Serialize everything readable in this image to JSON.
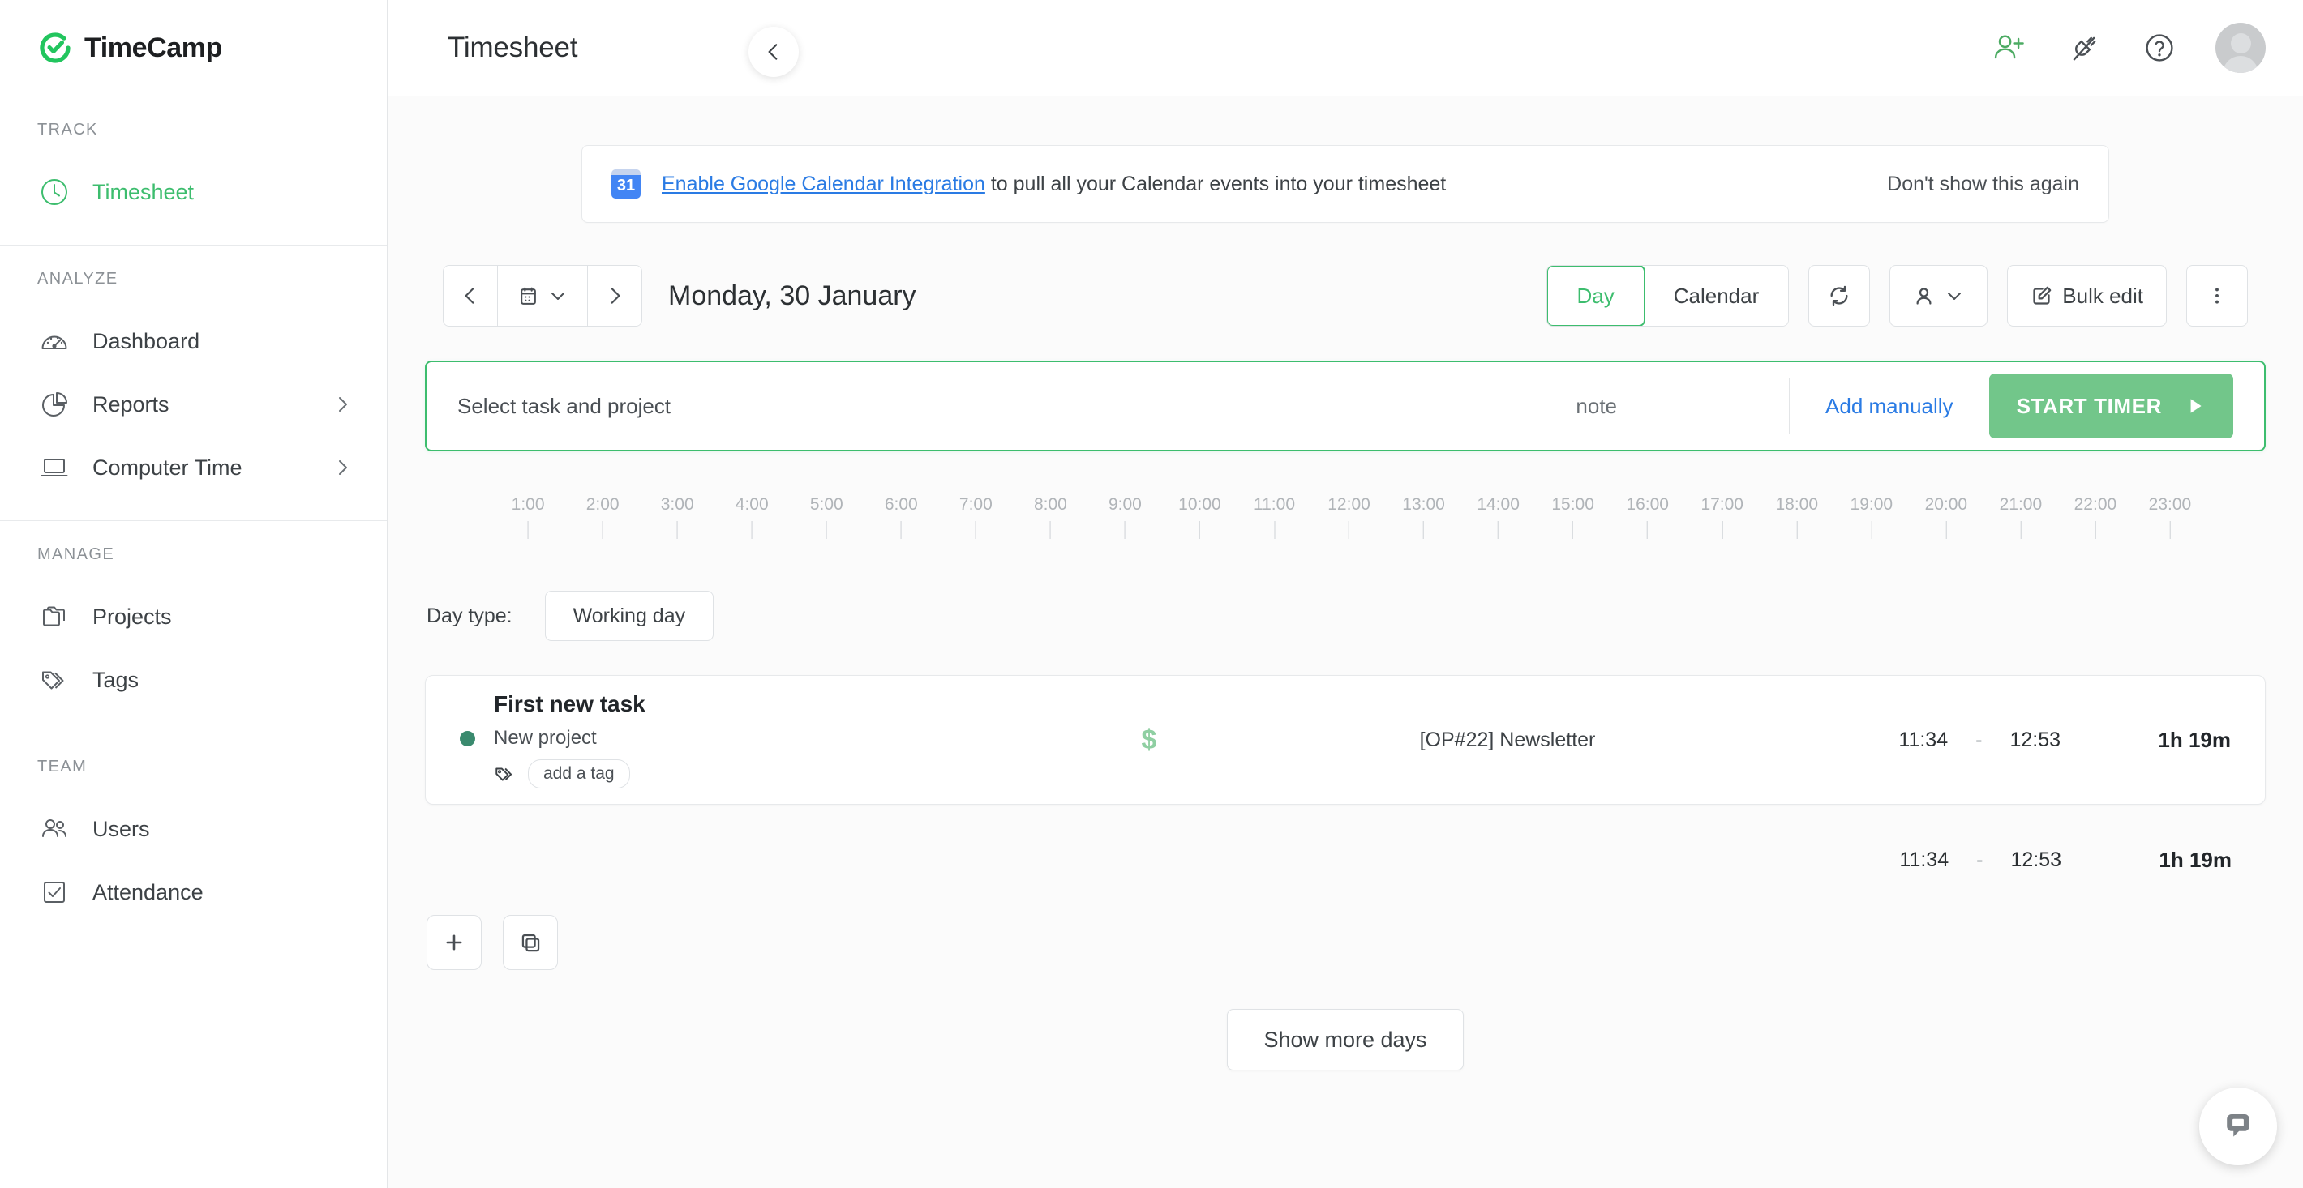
{
  "brand": {
    "name": "TimeCamp",
    "accent": "#3dbd6e"
  },
  "sidebar": {
    "sections": [
      {
        "label": "TRACK",
        "items": [
          {
            "label": "Timesheet",
            "icon": "clock-icon",
            "active": true,
            "chevron": false
          }
        ]
      },
      {
        "label": "ANALYZE",
        "items": [
          {
            "label": "Dashboard",
            "icon": "gauge-icon",
            "active": false,
            "chevron": false
          },
          {
            "label": "Reports",
            "icon": "pie-chart-icon",
            "active": false,
            "chevron": true
          },
          {
            "label": "Computer Time",
            "icon": "laptop-icon",
            "active": false,
            "chevron": true
          }
        ]
      },
      {
        "label": "MANAGE",
        "items": [
          {
            "label": "Projects",
            "icon": "folder-icon",
            "active": false,
            "chevron": false
          },
          {
            "label": "Tags",
            "icon": "tag-icon",
            "active": false,
            "chevron": false
          }
        ]
      },
      {
        "label": "TEAM",
        "items": [
          {
            "label": "Users",
            "icon": "users-icon",
            "active": false,
            "chevron": false
          },
          {
            "label": "Attendance",
            "icon": "checkbox-icon",
            "active": false,
            "chevron": false
          }
        ]
      }
    ]
  },
  "topbar": {
    "title": "Timesheet",
    "icons": [
      "add-user-icon",
      "plug-disconnected-icon",
      "help-circle-icon"
    ],
    "collapse": "collapse-sidebar-icon"
  },
  "banner": {
    "badge": "31",
    "link": "Enable Google Calendar Integration",
    "text": " to pull all your Calendar events into your timesheet",
    "dismiss": "Don't show this again"
  },
  "toolbar": {
    "date": "Monday, 30 January",
    "views": [
      {
        "label": "Day",
        "active": true
      },
      {
        "label": "Calendar",
        "active": false
      }
    ],
    "refresh": "refresh-icon",
    "person": "person-filter-icon",
    "bulk_edit": "Bulk edit",
    "more": "more-vertical-icon"
  },
  "timer": {
    "select_placeholder": "Select task and project",
    "note_placeholder": "note",
    "add_manually": "Add manually",
    "start_label": "START TIMER"
  },
  "ruler": {
    "hours": [
      "1:00",
      "2:00",
      "3:00",
      "4:00",
      "5:00",
      "6:00",
      "7:00",
      "8:00",
      "9:00",
      "10:00",
      "11:00",
      "12:00",
      "13:00",
      "14:00",
      "15:00",
      "16:00",
      "17:00",
      "18:00",
      "19:00",
      "20:00",
      "21:00",
      "22:00",
      "23:00"
    ]
  },
  "day_type": {
    "label": "Day type:",
    "value": "Working day"
  },
  "entries": [
    {
      "title": "First new task",
      "project": "New project",
      "project_color": "#3a8a6e",
      "tag_label": "add a tag",
      "billable": "$",
      "note": "[OP#22] Newsletter",
      "start": "11:34",
      "dash": "-",
      "end": "12:53",
      "duration": "1h 19m"
    }
  ],
  "totals": {
    "start": "11:34",
    "dash": "-",
    "end": "12:53",
    "duration": "1h 19m"
  },
  "bottom": {
    "add": "plus-icon",
    "duplicate": "duplicate-icon",
    "show_more": "Show more days"
  },
  "chat": {
    "icon": "chat-bubble-icon"
  }
}
